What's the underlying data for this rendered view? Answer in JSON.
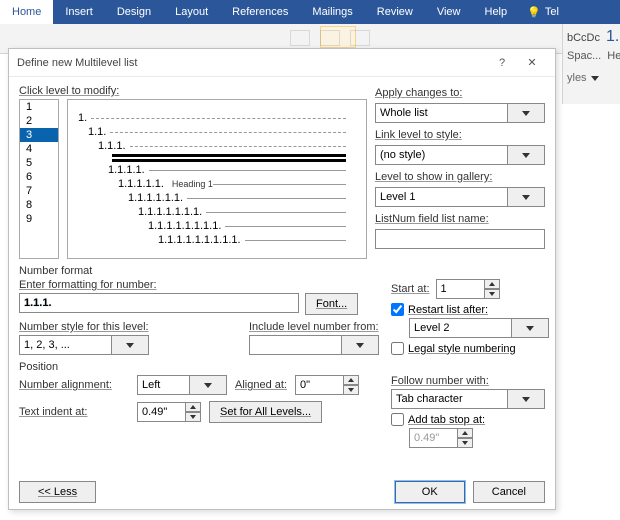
{
  "ribbon": {
    "tabs": [
      "Home",
      "Insert",
      "Design",
      "Layout",
      "References",
      "Mailings",
      "Review",
      "View",
      "Help"
    ],
    "active": "Home",
    "tell": "Tel"
  },
  "gallery": {
    "style_sample": "bCcDc",
    "num_sample": "1.",
    "row2a": "Spac...",
    "row2b": "He",
    "label": "yles"
  },
  "dialog": {
    "title": "Define new Multilevel list",
    "help": "?",
    "close": "✕",
    "click_level": "Click level to modify:",
    "levels": [
      "1",
      "2",
      "3",
      "4",
      "5",
      "6",
      "7",
      "8",
      "9"
    ],
    "selected_level": 2,
    "preview": {
      "rows": [
        {
          "indent": 0,
          "num": "1.",
          "style": "dash"
        },
        {
          "indent": 1,
          "num": "1.1.",
          "style": "dash"
        },
        {
          "indent": 2,
          "num": "1.1.1.",
          "style": "dash"
        },
        {
          "indent": 3,
          "num": "",
          "style": "thick"
        },
        {
          "indent": 3,
          "num": "",
          "style": "thick"
        },
        {
          "indent": 3,
          "num": "1.1.1.1.",
          "style": "solid"
        },
        {
          "indent": 4,
          "num": "1.1.1.1.1.",
          "style": "solid",
          "tag": "Heading 1"
        },
        {
          "indent": 5,
          "num": "1.1.1.1.1.1.",
          "style": "solid"
        },
        {
          "indent": 6,
          "num": "1.1.1.1.1.1.1.",
          "style": "solid"
        },
        {
          "indent": 7,
          "num": "1.1.1.1.1.1.1.1.",
          "style": "solid"
        },
        {
          "indent": 8,
          "num": "1.1.1.1.1.1.1.1.1.",
          "style": "solid"
        }
      ]
    },
    "apply_to_label": "Apply changes to:",
    "apply_to": "Whole list",
    "link_style_label": "Link level to style:",
    "link_style": "(no style)",
    "show_gallery_label": "Level to show in gallery:",
    "show_gallery": "Level 1",
    "listnum_label": "ListNum field list name:",
    "listnum": "",
    "nf_title": "Number format",
    "enter_fmt_label": "Enter formatting for number:",
    "enter_fmt": "1.1.1.",
    "font_btn": "Font...",
    "num_style_label": "Number style for this level:",
    "num_style": "1, 2, 3, ...",
    "include_from_label": "Include level number from:",
    "include_from": "",
    "start_at_label": "Start at:",
    "start_at": "1",
    "restart_label": "Restart list after:",
    "restart_checked": true,
    "restart_level": "Level 2",
    "legal_label": "Legal style numbering",
    "legal_checked": false,
    "pos_title": "Position",
    "num_align_label": "Number alignment:",
    "num_align": "Left",
    "aligned_at_label": "Aligned at:",
    "aligned_at": "0\"",
    "indent_at_label": "Text indent at:",
    "indent_at": "0.49\"",
    "set_all_btn": "Set for All Levels...",
    "follow_label": "Follow number with:",
    "follow": "Tab character",
    "add_tab_label": "Add tab stop at:",
    "add_tab_checked": false,
    "add_tab_val": "0.49\"",
    "less_btn": "<< Less",
    "ok_btn": "OK",
    "cancel_btn": "Cancel"
  }
}
